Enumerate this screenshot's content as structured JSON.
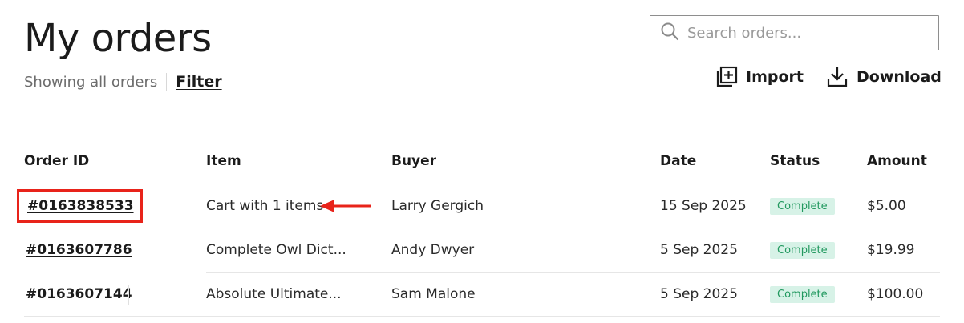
{
  "header": {
    "title": "My orders",
    "showing_text": "Showing all orders",
    "filter_label": "Filter"
  },
  "search": {
    "placeholder": "Search orders...",
    "value": ""
  },
  "actions": {
    "import_label": "Import",
    "download_label": "Download"
  },
  "table": {
    "columns": [
      "Order ID",
      "Item",
      "Buyer",
      "Date",
      "Status",
      "Amount"
    ],
    "rows": [
      {
        "id": "#0163838533",
        "item": "Cart with 1 items",
        "buyer": "Larry Gergich",
        "date": "15 Sep 2025",
        "status": "Complete",
        "amount": "$5.00"
      },
      {
        "id": "#0163607786",
        "item": "Complete Owl Dict...",
        "buyer": "Andy Dwyer",
        "date": "5 Sep 2025",
        "status": "Complete",
        "amount": "$19.99"
      },
      {
        "id": "#0163607144",
        "item": "Absolute Ultimate...",
        "buyer": "Sam Malone",
        "date": "5 Sep 2025",
        "status": "Complete",
        "amount": "$100.00"
      }
    ]
  },
  "annotation": {
    "highlight_color": "#e8231a",
    "highlighted_order": "#0163838533"
  },
  "colors": {
    "badge_bg": "#d7f2e7",
    "badge_text": "#22995f"
  },
  "icons": {
    "search": "search-icon",
    "import": "import-icon",
    "download": "download-icon",
    "arrow": "arrow-left-icon"
  }
}
